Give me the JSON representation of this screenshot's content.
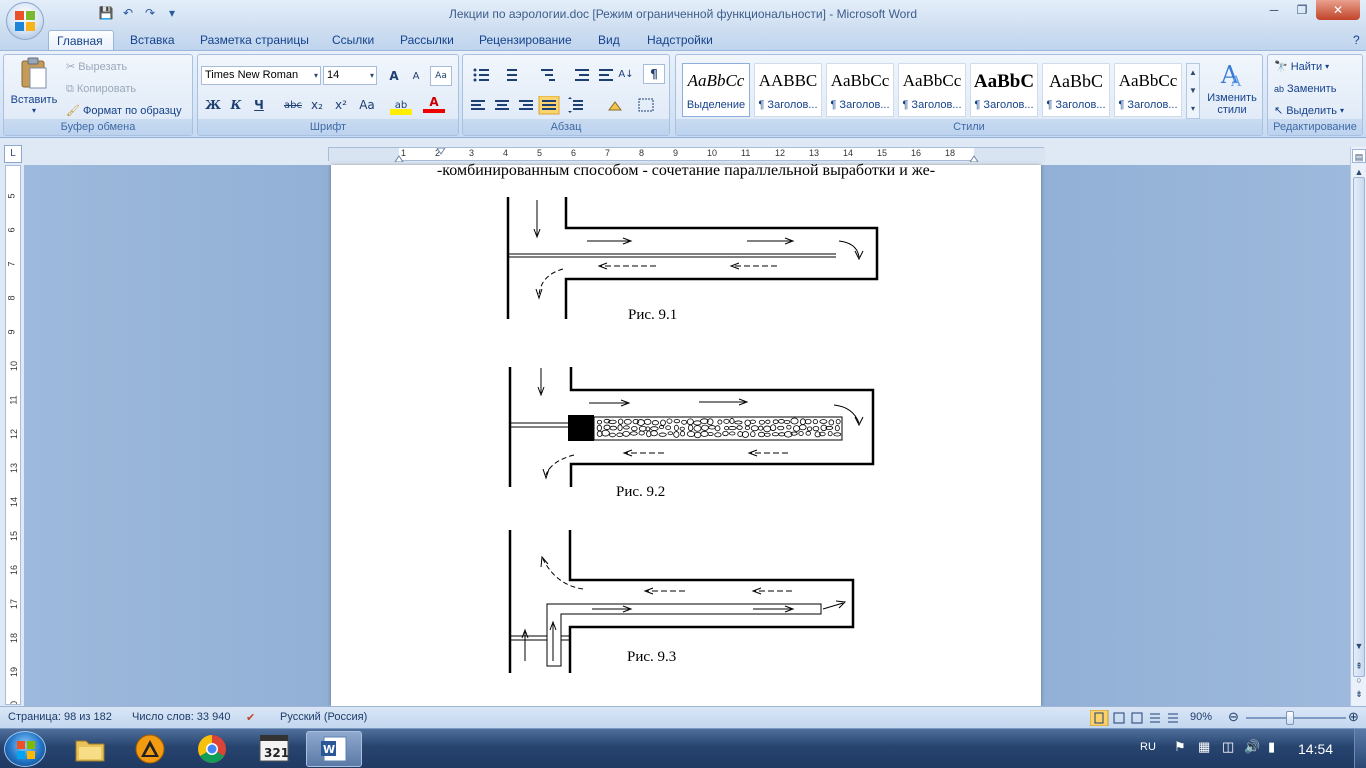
{
  "window": {
    "title": "Лекции по аэрологии.doc [Режим ограниченной функциональности] - Microsoft Word",
    "controls": {
      "minimize": "─",
      "maximize": "❐",
      "close": "✕"
    }
  },
  "quick_access": {
    "save": "💾",
    "undo": "↶",
    "redo": "↷",
    "more": "▾"
  },
  "tabs": [
    {
      "label": "Главная"
    },
    {
      "label": "Вставка"
    },
    {
      "label": "Разметка страницы"
    },
    {
      "label": "Ссылки"
    },
    {
      "label": "Рассылки"
    },
    {
      "label": "Рецензирование"
    },
    {
      "label": "Вид"
    },
    {
      "label": "Надстройки"
    }
  ],
  "ribbon": {
    "clipboard": {
      "label": "Буфер обмена",
      "paste": "Вставить",
      "cut": "Вырезать",
      "copy": "Копировать",
      "format_painter": "Формат по образцу"
    },
    "font": {
      "label": "Шрифт",
      "family": "Times New Roman",
      "size": "14",
      "grow": "A",
      "shrink": "A",
      "clear": "Aa",
      "bold": "Ж",
      "italic": "К",
      "underline": "Ч",
      "strike": "abc",
      "sub": "x₂",
      "sup": "x²",
      "case": "Aa",
      "highlight": "ab",
      "color": "A"
    },
    "paragraph": {
      "label": "Абзац",
      "pilcrow": "¶",
      "sort": "A↓"
    },
    "styles": {
      "label": "Стили",
      "items": [
        {
          "sample": "AaBbCc",
          "name": "Выделение"
        },
        {
          "sample": "AABBC",
          "name": "¶ Заголов..."
        },
        {
          "sample": "AaBbCc",
          "name": "¶ Заголов..."
        },
        {
          "sample": "AaBbCc",
          "name": "¶ Заголов..."
        },
        {
          "sample": "AaBbC",
          "name": "¶ Заголов..."
        },
        {
          "sample": "AaBbC",
          "name": "¶ Заголов..."
        },
        {
          "sample": "AaBbCc",
          "name": "¶ Заголов..."
        }
      ],
      "change_styles": "Изменить стили"
    },
    "editing": {
      "label": "Редактирование",
      "find": "Найти",
      "replace": "Заменить",
      "select": "Выделить"
    }
  },
  "ruler": {
    "corner": "L",
    "h_labels": [
      "2",
      "1",
      "1",
      "2",
      "3",
      "4",
      "5",
      "6",
      "7",
      "8",
      "9",
      "10",
      "11",
      "12",
      "13",
      "14",
      "15",
      "16",
      "18"
    ],
    "v_labels": [
      "5",
      "6",
      "7",
      "8",
      "9",
      "10",
      "11",
      "12",
      "13",
      "14",
      "15",
      "16",
      "17",
      "18",
      "19",
      "20"
    ]
  },
  "document": {
    "text_line": "-комбинированным способом - сочетание параллельной выработки и же-",
    "captions": [
      "Рис. 9.1",
      "Рис. 9.2",
      "Рис. 9.3"
    ]
  },
  "statusbar": {
    "page": "Страница: 98 из 182",
    "words": "Число слов: 33 940",
    "language": "Русский (Россия)",
    "zoom": "90%",
    "zoom_level": 0.9
  },
  "taskbar": {
    "lang": "RU",
    "time": "14:54",
    "apps": [
      "explorer",
      "aimp",
      "chrome",
      "media-player-classic",
      "word"
    ]
  },
  "colors": {
    "ribbon_text": "#15428b",
    "close": "#c0442a",
    "taskbar": "#27446f"
  }
}
